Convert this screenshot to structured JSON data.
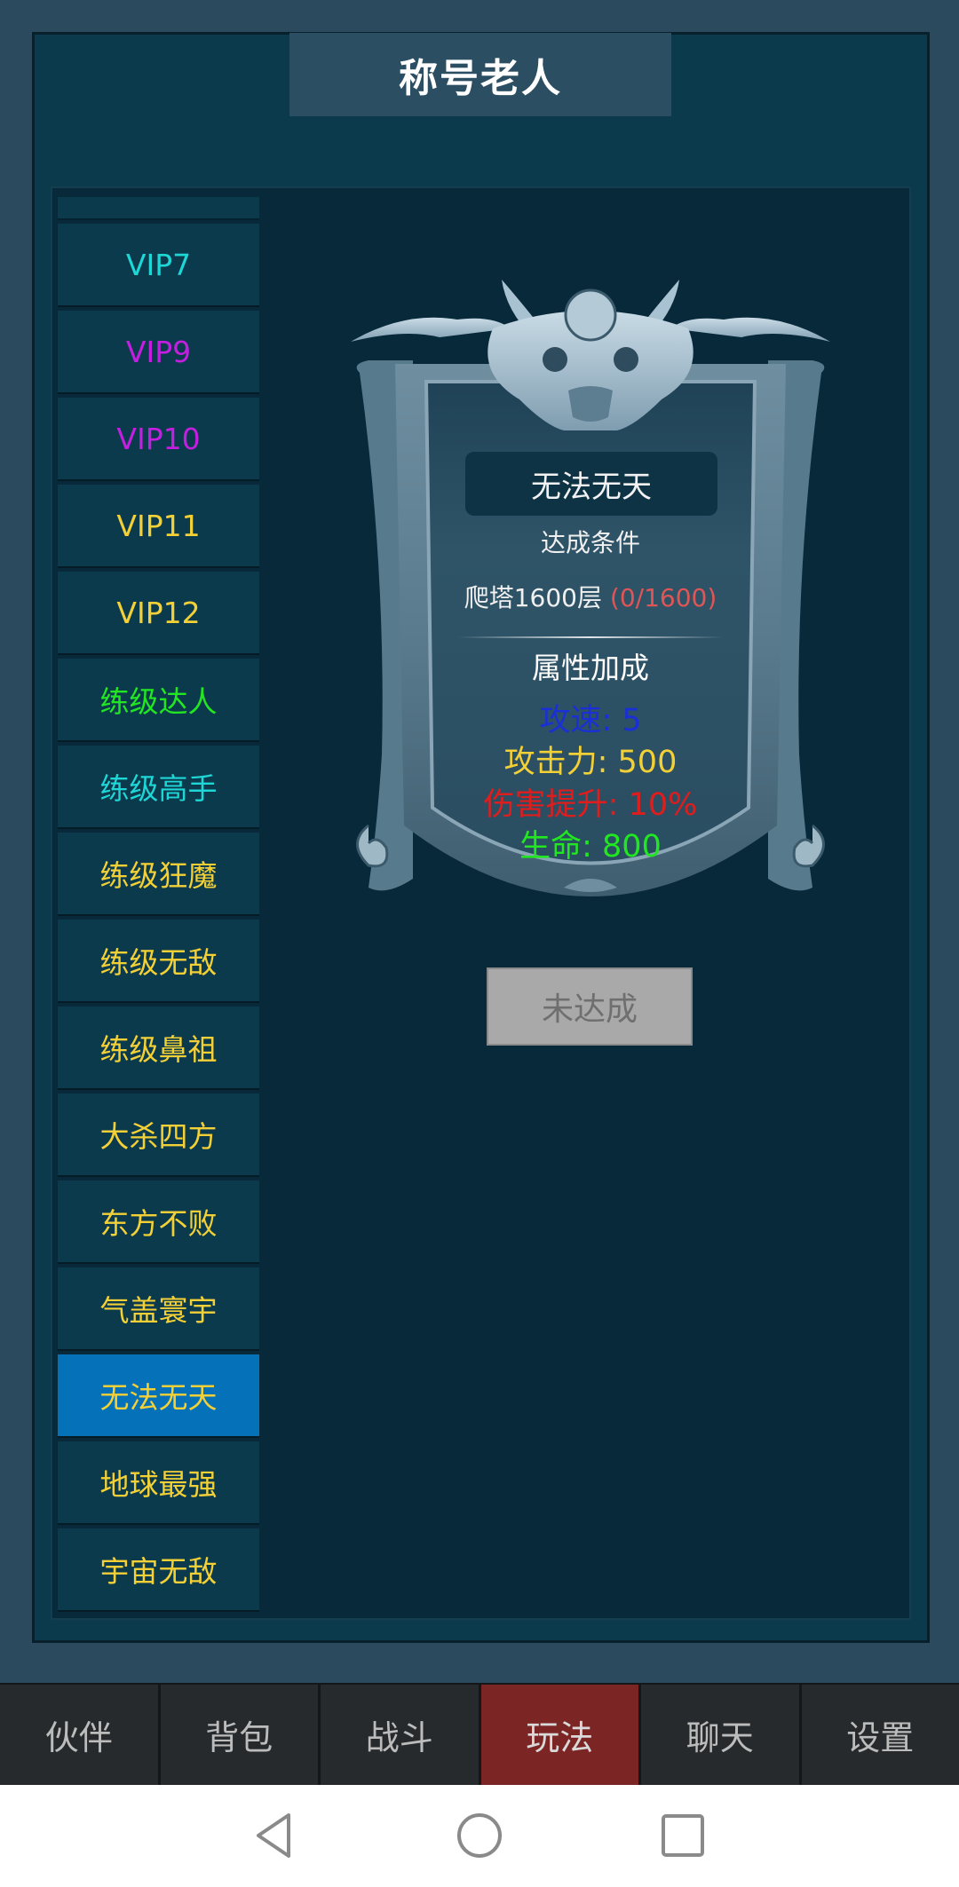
{
  "header": {
    "title": "称号老人"
  },
  "title_list": [
    {
      "label": "VIP7",
      "color": "#1fd6d6"
    },
    {
      "label": "VIP9",
      "color": "#c41fe0"
    },
    {
      "label": "VIP10",
      "color": "#c41fe0"
    },
    {
      "label": "VIP11",
      "color": "#f3d136"
    },
    {
      "label": "VIP12",
      "color": "#f3d136"
    },
    {
      "label": "练级达人",
      "color": "#22e622"
    },
    {
      "label": "练级高手",
      "color": "#1fd6d6"
    },
    {
      "label": "练级狂魔",
      "color": "#f3d136"
    },
    {
      "label": "练级无敌",
      "color": "#f3d136"
    },
    {
      "label": "练级鼻祖",
      "color": "#f3d136"
    },
    {
      "label": "大杀四方",
      "color": "#f3d136"
    },
    {
      "label": "东方不败",
      "color": "#f3d136"
    },
    {
      "label": "气盖寰宇",
      "color": "#f3d136"
    },
    {
      "label": "无法无天",
      "color": "#f3d136",
      "selected": true
    },
    {
      "label": "地球最强",
      "color": "#f3d136"
    },
    {
      "label": "宇宙无敌",
      "color": "#f3d136"
    }
  ],
  "detail": {
    "name": "无法无天",
    "condition_label": "达成条件",
    "condition_text": "爬塔1600层 ",
    "condition_progress": "(0/1600)",
    "attr_heading": "属性加成",
    "attributes": [
      "攻速: 5",
      "攻击力: 500",
      "伤害提升: 10%",
      "生命: 800"
    ],
    "status_button": "未达成"
  },
  "tabs": [
    {
      "label": "伙伴",
      "active": false
    },
    {
      "label": "背包",
      "active": false
    },
    {
      "label": "战斗",
      "active": false
    },
    {
      "label": "玩法",
      "active": true
    },
    {
      "label": "聊天",
      "active": false
    },
    {
      "label": "设置",
      "active": false
    }
  ],
  "nav": {
    "back_icon": "back-triangle-icon",
    "home_icon": "home-circle-icon",
    "recent_icon": "recent-square-icon"
  },
  "colors": {
    "selected_item": "#0571b8",
    "active_tab": "#7c2525",
    "panel": "#0b3a4d"
  }
}
